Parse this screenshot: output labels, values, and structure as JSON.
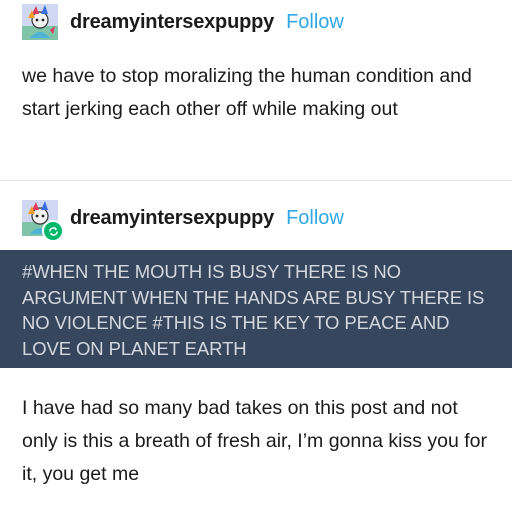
{
  "post1": {
    "username": "dreamyintersexpuppy",
    "follow_label": "Follow",
    "text": "we have to stop moralizing the human condition and start jerking each other off while making out"
  },
  "post2": {
    "username": "dreamyintersexpuppy",
    "follow_label": "Follow",
    "tags": "#WHEN THE MOUTH IS BUSY THERE IS NO ARGUMENT WHEN THE HANDS ARE BUSY THERE IS NO VIOLENCE  #THIS IS THE KEY TO PEACE AND LOVE ON PLANET EARTH"
  },
  "comment": {
    "text": "I have had so many bad takes on this post and not only is this a breath of fresh air, I’m gonna kiss you for it, you get me"
  },
  "colors": {
    "follow": "#2fa8e6",
    "tags_bg": "#36465d",
    "reblog_badge": "#00b86b"
  },
  "icons": {
    "avatar": "avatar-icon",
    "reblog": "reblog-icon"
  }
}
